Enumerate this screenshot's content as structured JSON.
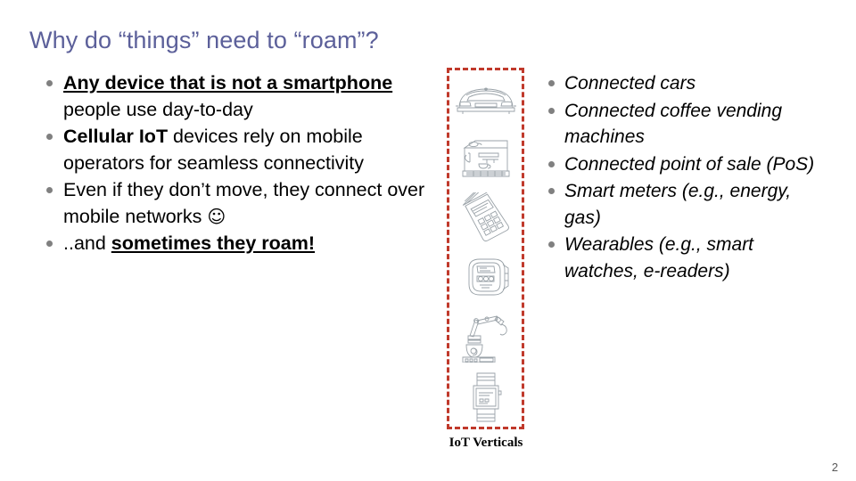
{
  "slide": {
    "title": "Why do “things” need to “roam”?",
    "page_number": "2",
    "title_color": "#5c609a",
    "accent_color": "#c0392b",
    "bullet_color": "#808080"
  },
  "left_column": {
    "items": [
      {
        "segments": [
          {
            "text": "Any device that is not a smartphone",
            "style": "bold-underline"
          },
          {
            "text": " people use day-to-day",
            "style": "plain"
          }
        ]
      },
      {
        "segments": [
          {
            "text": "Cellular IoT",
            "style": "bold"
          },
          {
            "text": " devices rely on mobile operators for seamless connectivity",
            "style": "plain"
          }
        ]
      },
      {
        "segments": [
          {
            "text": "Even if they don’t move, they connect over mobile networks ",
            "style": "plain"
          },
          {
            "text": "☺",
            "style": "smiley"
          }
        ]
      },
      {
        "segments": [
          {
            "text": "..and ",
            "style": "plain"
          },
          {
            "text": "sometimes they roam!",
            "style": "bold-underline"
          }
        ]
      }
    ]
  },
  "right_column": {
    "items": [
      {
        "text": "Connected cars"
      },
      {
        "text": "Connected coffee vending machines"
      },
      {
        "text": "Connected point of sale (PoS)"
      },
      {
        "text": "Smart meters (e.g., energy, gas)"
      },
      {
        "text": "Wearables (e.g., smart watches, e-readers)"
      }
    ]
  },
  "figure": {
    "caption": "IoT Verticals",
    "icons": [
      {
        "name": "connected-car-icon",
        "label": "car"
      },
      {
        "name": "coffee-machine-icon",
        "label": "coffee vending machine"
      },
      {
        "name": "pos-terminal-icon",
        "label": "point of sale terminal"
      },
      {
        "name": "smart-meter-icon",
        "label": "smart meter"
      },
      {
        "name": "robot-arm-icon",
        "label": "industrial robot arm"
      },
      {
        "name": "smart-watch-icon",
        "label": "smart watch"
      }
    ]
  }
}
